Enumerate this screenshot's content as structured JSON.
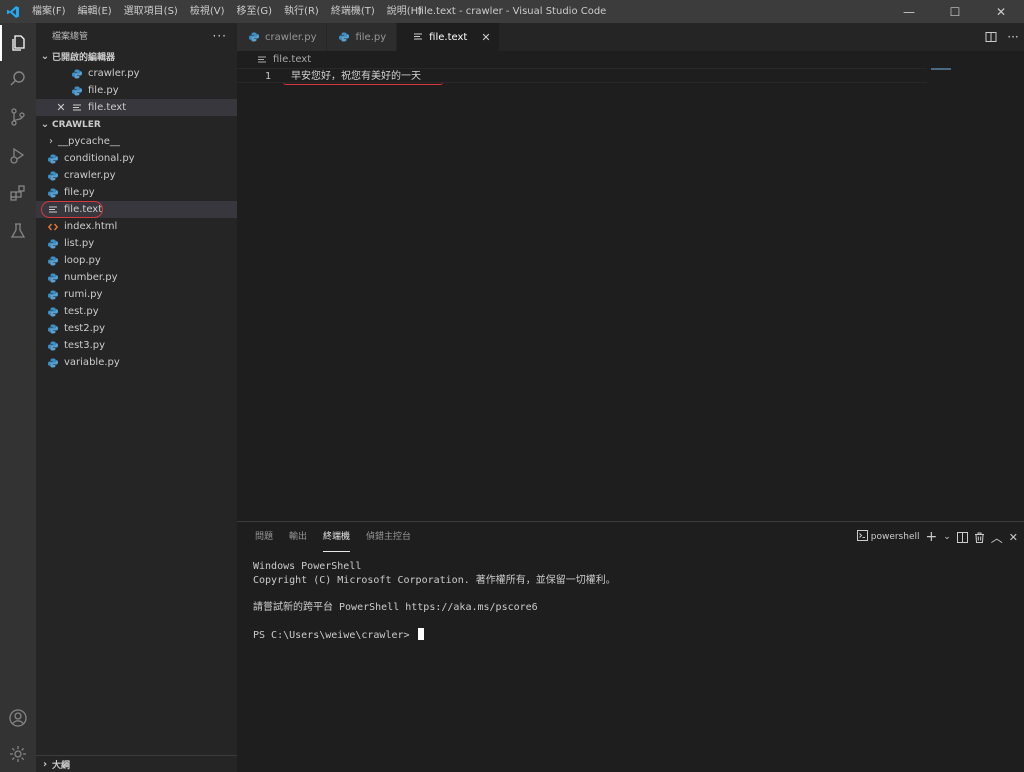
{
  "titlebar": {
    "menu": [
      "檔案(F)",
      "編輯(E)",
      "選取項目(S)",
      "檢視(V)",
      "移至(G)",
      "執行(R)",
      "終端機(T)",
      "說明(H)"
    ],
    "title": "file.text - crawler - Visual Studio Code",
    "controls": {
      "minimize": "—",
      "maximize": "☐",
      "close": "✕"
    }
  },
  "activity_bar": {
    "icons": [
      "files-icon",
      "search-icon",
      "source-control-icon",
      "run-debug-icon",
      "extensions-icon",
      "testing-icon",
      "account-icon",
      "settings-gear-icon"
    ]
  },
  "sidebar": {
    "header": "檔案總管",
    "more": "···",
    "open_editors": {
      "title": "已開啟的編輯器",
      "items": [
        {
          "name": "crawler.py",
          "type": "python"
        },
        {
          "name": "file.py",
          "type": "python"
        },
        {
          "name": "file.text",
          "type": "text",
          "active": true
        }
      ]
    },
    "folder": {
      "title": "CRAWLER",
      "items": [
        {
          "name": "__pycache__",
          "type": "folder"
        },
        {
          "name": "conditional.py",
          "type": "python"
        },
        {
          "name": "crawler.py",
          "type": "python"
        },
        {
          "name": "file.py",
          "type": "python"
        },
        {
          "name": "file.text",
          "type": "text",
          "selected": true
        },
        {
          "name": "index.html",
          "type": "html"
        },
        {
          "name": "list.py",
          "type": "python"
        },
        {
          "name": "loop.py",
          "type": "python"
        },
        {
          "name": "number.py",
          "type": "python"
        },
        {
          "name": "rumi.py",
          "type": "python"
        },
        {
          "name": "test.py",
          "type": "python"
        },
        {
          "name": "test2.py",
          "type": "python"
        },
        {
          "name": "test3.py",
          "type": "python"
        },
        {
          "name": "variable.py",
          "type": "python"
        }
      ]
    },
    "outline": "大綱"
  },
  "tabs": [
    {
      "label": "crawler.py",
      "type": "python"
    },
    {
      "label": "file.py",
      "type": "python"
    },
    {
      "label": "file.text",
      "type": "text",
      "active": true,
      "close": "✕"
    }
  ],
  "editor": {
    "breadcrumb": "file.text",
    "lines": [
      {
        "number": "1",
        "text": "早安您好，祝您有美好的一天"
      }
    ]
  },
  "panel": {
    "tabs": [
      "問題",
      "輸出",
      "終端機",
      "偵錯主控台"
    ],
    "active_tab": "終端機",
    "shell_label": "powershell",
    "terminal_lines": [
      "Windows PowerShell",
      "Copyright (C) Microsoft Corporation. 著作權所有，並保留一切權利。",
      "",
      "請嘗試新的跨平台 PowerShell https://aka.ms/pscore6",
      "",
      "PS C:\\Users\\weiwe\\crawler> "
    ]
  },
  "colors": {
    "accent_blue": "#3794ff",
    "python_icon": "#3b8fc7",
    "html_icon": "#e37933",
    "annotation_red": "#d9363e"
  }
}
